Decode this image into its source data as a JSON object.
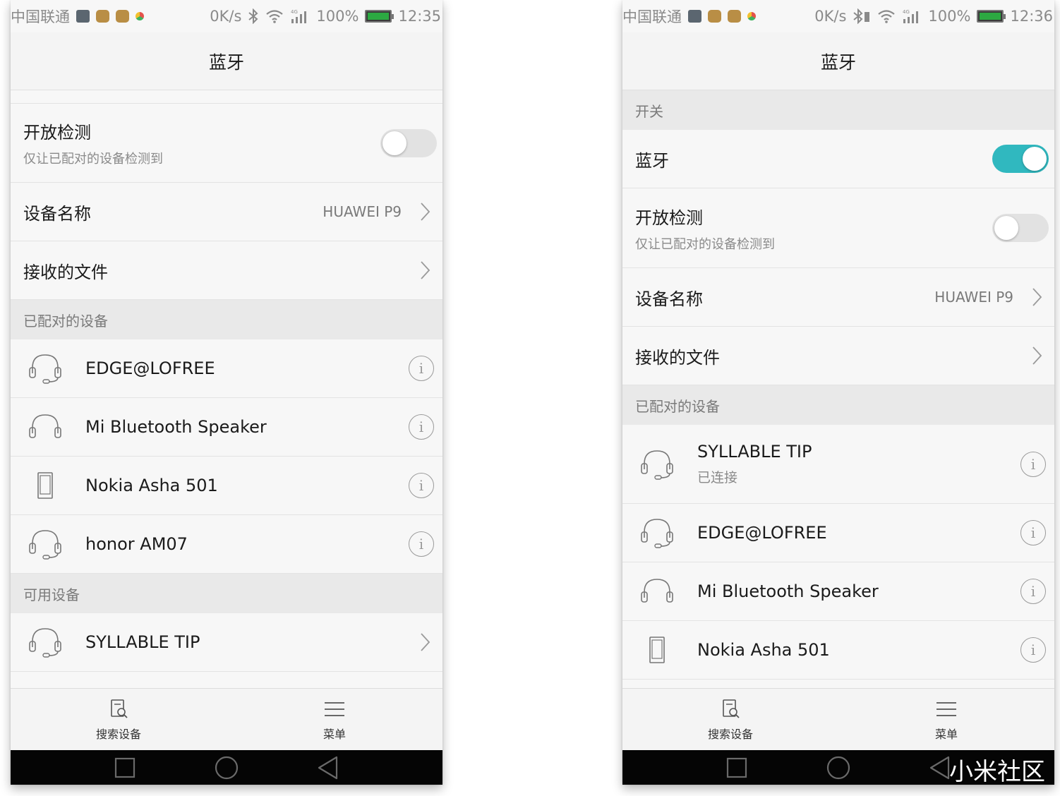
{
  "left": {
    "status": {
      "carrier": "中国联通",
      "speed": "0K/s",
      "network": "4G",
      "battery": "100%",
      "time": "12:35"
    },
    "title": "蓝牙",
    "open_detection": {
      "label": "开放检测",
      "sub": "仅让已配对的设备检测到",
      "on": false
    },
    "device_name": {
      "label": "设备名称",
      "value": "HUAWEI P9"
    },
    "received_files": {
      "label": "接收的文件"
    },
    "paired_header": "已配对的设备",
    "paired": [
      {
        "name": "EDGE@LOFREE",
        "icon": "headset-icon"
      },
      {
        "name": "Mi Bluetooth Speaker",
        "icon": "headphones-icon"
      },
      {
        "name": "Nokia Asha 501",
        "icon": "phone-icon"
      },
      {
        "name": "honor AM07",
        "icon": "headset-icon"
      }
    ],
    "available_header": "可用设备",
    "available": [
      {
        "name": "SYLLABLE TIP",
        "icon": "headset-icon"
      }
    ],
    "bottom": {
      "search": "搜索设备",
      "menu": "菜单"
    }
  },
  "right": {
    "status": {
      "carrier": "中国联通",
      "speed": "0K/s",
      "network": "4G",
      "battery": "100%",
      "time": "12:36"
    },
    "title": "蓝牙",
    "switch_header": "开关",
    "bluetooth": {
      "label": "蓝牙",
      "on": true
    },
    "open_detection": {
      "label": "开放检测",
      "sub": "仅让已配对的设备检测到",
      "on": false
    },
    "device_name": {
      "label": "设备名称",
      "value": "HUAWEI P9"
    },
    "received_files": {
      "label": "接收的文件"
    },
    "paired_header": "已配对的设备",
    "paired": [
      {
        "name": "SYLLABLE TIP",
        "status": "已连接",
        "icon": "headset-icon"
      },
      {
        "name": "EDGE@LOFREE",
        "icon": "headset-icon"
      },
      {
        "name": "Mi Bluetooth Speaker",
        "icon": "headphones-icon"
      },
      {
        "name": "Nokia Asha 501",
        "icon": "phone-icon"
      }
    ],
    "bottom": {
      "search": "搜索设备",
      "menu": "菜单"
    }
  },
  "watermark": "小米社区",
  "colors": {
    "accent": "#30b8bf",
    "toggle_off": "#e2e2e2",
    "section_bg": "#e9e9e9",
    "row_bg": "#f7f7f7"
  }
}
